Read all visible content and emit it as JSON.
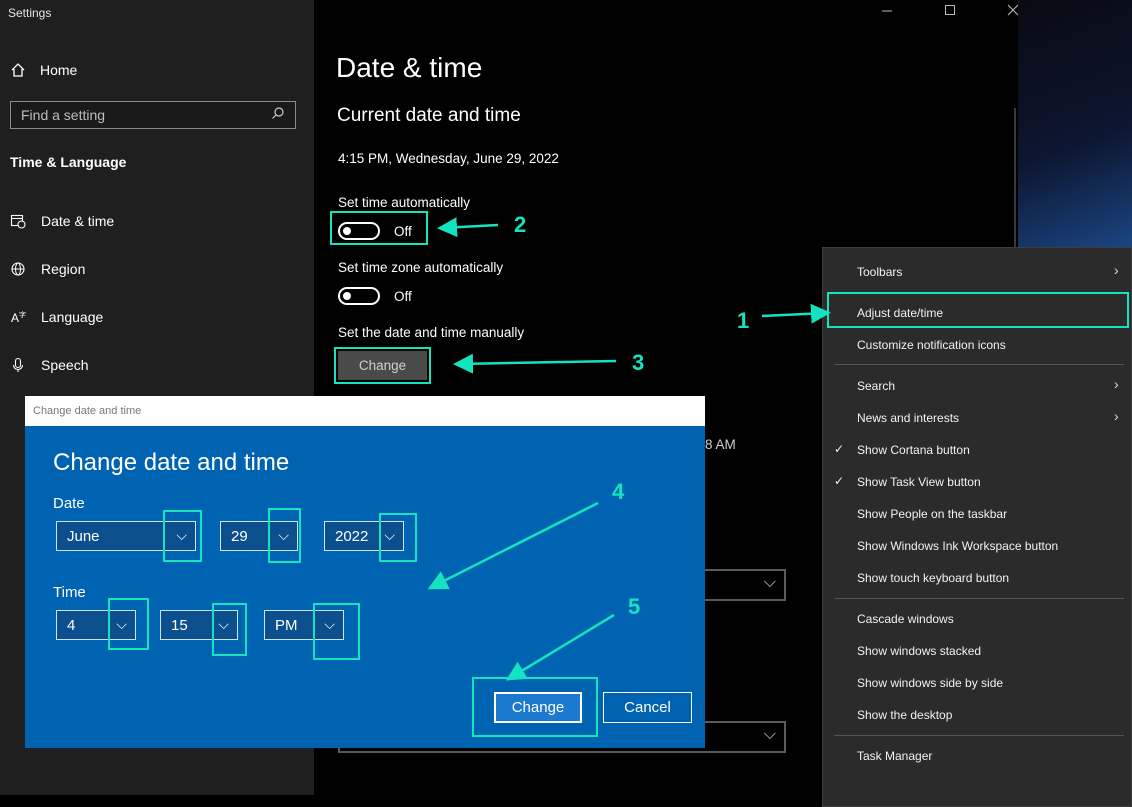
{
  "app": {
    "title": "Settings"
  },
  "sidebar": {
    "home_label": "Home",
    "search_placeholder": "Find a setting",
    "section_title": "Time & Language",
    "items": [
      {
        "label": "Date & time",
        "icon": "calendar-clock-icon"
      },
      {
        "label": "Region",
        "icon": "globe-icon"
      },
      {
        "label": "Language",
        "icon": "language-icon"
      },
      {
        "label": "Speech",
        "icon": "microphone-icon"
      }
    ]
  },
  "main": {
    "page_title": "Date & time",
    "section_heading": "Current date and time",
    "current_datetime": "4:15 PM, Wednesday, June 29, 2022",
    "set_time_auto": {
      "label": "Set time automatically",
      "state": "Off"
    },
    "set_timezone_auto": {
      "label": "Set time zone automatically",
      "state": "Off"
    },
    "manual": {
      "label": "Set the date and time manually",
      "button": "Change"
    },
    "partial_text": "8 AM"
  },
  "context_menu": {
    "items": [
      {
        "label": "Toolbars",
        "submenu": true
      },
      {
        "label": "Adjust date/time"
      },
      {
        "label": "Customize notification icons"
      },
      {
        "label": "Search",
        "submenu": true
      },
      {
        "label": "News and interests",
        "submenu": true
      },
      {
        "label": "Show Cortana button",
        "checked": true
      },
      {
        "label": "Show Task View button",
        "checked": true
      },
      {
        "label": "Show People on the taskbar"
      },
      {
        "label": "Show Windows Ink Workspace button"
      },
      {
        "label": "Show touch keyboard button"
      },
      {
        "label": "Cascade windows"
      },
      {
        "label": "Show windows stacked"
      },
      {
        "label": "Show windows side by side"
      },
      {
        "label": "Show the desktop"
      },
      {
        "label": "Task Manager"
      }
    ]
  },
  "dialog": {
    "window_title": "Change date and time",
    "heading": "Change date and time",
    "date_label": "Date",
    "month": "June",
    "day": "29",
    "year": "2022",
    "time_label": "Time",
    "hour": "4",
    "minute": "15",
    "ampm": "PM",
    "change_button": "Change",
    "cancel_button": "Cancel"
  },
  "annotations": {
    "step1": "1",
    "step2": "2",
    "step3": "3",
    "step4": "4",
    "step5": "5",
    "color": "#14e3c0"
  },
  "colors": {
    "dialog_blue": "#0063b1",
    "sidebar_bg": "#1f1f1f",
    "menu_bg": "#2b2b2b"
  }
}
